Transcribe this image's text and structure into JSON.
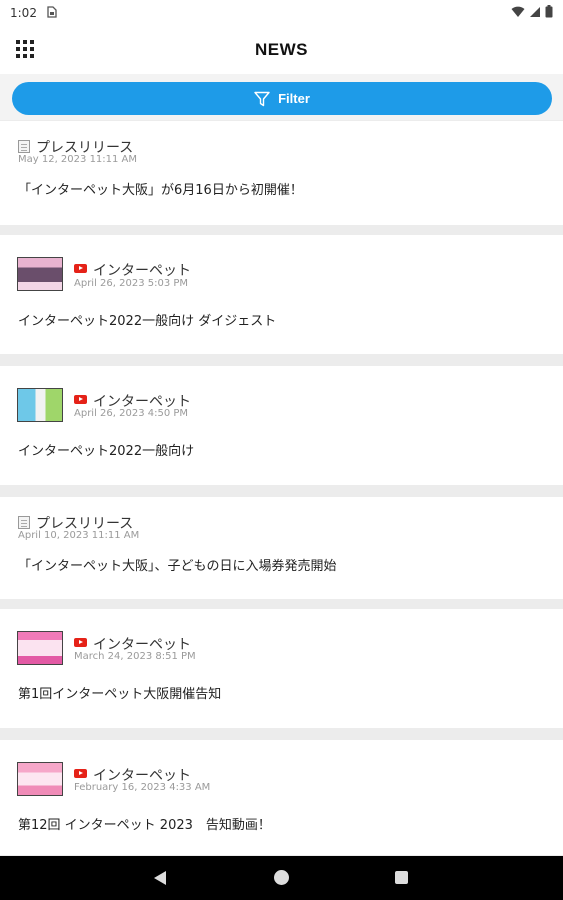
{
  "status_bar": {
    "time": "1:02",
    "sim_icon": "sim-card-icon",
    "icons": [
      "wifi-icon",
      "signal-icon",
      "battery-icon"
    ]
  },
  "app_bar": {
    "title": "NEWS",
    "menu_icon": "apps-grid-icon"
  },
  "filter": {
    "label": "Filter",
    "icon": "funnel-icon",
    "color": "#1e9be8"
  },
  "news": [
    {
      "type": "press",
      "source": "プレスリリース",
      "date": "May 12, 2023 11:11 AM",
      "headline": "「インターペット大阪」が6月16日から初開催！"
    },
    {
      "type": "video",
      "source": "インターペット",
      "date": "April 26, 2023 5:03 PM",
      "headline": "インターペット2022一般向け ダイジェスト"
    },
    {
      "type": "video",
      "source": "インターペット",
      "date": "April 26, 2023 4:50 PM",
      "headline": "インターペット2022一般向け"
    },
    {
      "type": "press",
      "source": "プレスリリース",
      "date": "April 10, 2023 11:11 AM",
      "headline": "「インターペット大阪」、子どもの日に入場券発売開始"
    },
    {
      "type": "video",
      "source": "インターペット",
      "date": "March 24, 2023 8:51 PM",
      "headline": "第1回インターペット大阪開催告知"
    },
    {
      "type": "video",
      "source": "インターペット",
      "date": "February 16, 2023 4:33 AM",
      "headline": "第12回 インターペット 2023　告知動画！"
    }
  ],
  "nav_bar": {
    "icons": [
      "back-icon",
      "home-icon",
      "recents-icon"
    ]
  }
}
